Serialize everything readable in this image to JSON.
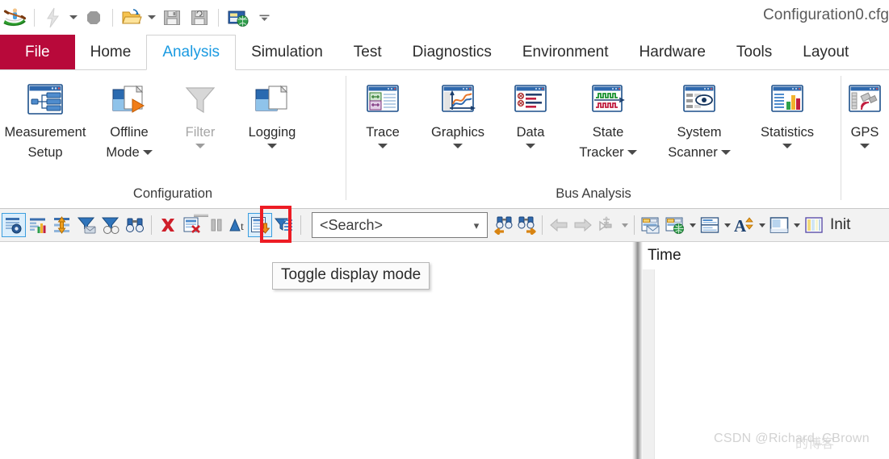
{
  "window": {
    "title": "Configuration0.cfg"
  },
  "quick_access": {
    "app_icon": "kayak-logo-icon",
    "items": [
      {
        "name": "lightning-icon",
        "label": ""
      },
      {
        "name": "stop-record-icon",
        "label": ""
      },
      {
        "name": "open-folder-icon",
        "label": ""
      },
      {
        "name": "save-icon",
        "label": ""
      },
      {
        "name": "save-as-icon",
        "label": ""
      },
      {
        "name": "network-config-icon",
        "label": ""
      }
    ],
    "overflow_label": "customize-quick-access"
  },
  "tabs": [
    {
      "label": "File",
      "active": false,
      "kind": "file"
    },
    {
      "label": "Home",
      "active": false,
      "kind": "normal"
    },
    {
      "label": "Analysis",
      "active": true,
      "kind": "normal"
    },
    {
      "label": "Simulation",
      "active": false,
      "kind": "normal"
    },
    {
      "label": "Test",
      "active": false,
      "kind": "normal"
    },
    {
      "label": "Diagnostics",
      "active": false,
      "kind": "normal"
    },
    {
      "label": "Environment",
      "active": false,
      "kind": "normal"
    },
    {
      "label": "Hardware",
      "active": false,
      "kind": "normal"
    },
    {
      "label": "Tools",
      "active": false,
      "kind": "normal"
    },
    {
      "label": "Layout",
      "active": false,
      "kind": "normal"
    }
  ],
  "ribbon": {
    "groups": [
      {
        "title": "Configuration",
        "buttons": [
          {
            "name": "measurement-setup",
            "line1": "Measurement",
            "line2": "Setup",
            "icon": "measurement-setup-icon",
            "dropdown": false,
            "disabled": false
          },
          {
            "name": "offline-mode",
            "line1": "Offline",
            "line2": "Mode",
            "icon": "offline-mode-icon",
            "dropdown": true,
            "inline_caret": true,
            "disabled": false
          },
          {
            "name": "filter",
            "line1": "Filter",
            "line2": "",
            "icon": "filter-icon",
            "dropdown": true,
            "inline_caret": false,
            "disabled": true
          },
          {
            "name": "logging",
            "line1": "Logging",
            "line2": "",
            "icon": "logging-icon",
            "dropdown": true,
            "inline_caret": false,
            "disabled": false
          }
        ]
      },
      {
        "title": "Bus Analysis",
        "buttons": [
          {
            "name": "trace",
            "line1": "Trace",
            "line2": "",
            "icon": "trace-icon",
            "dropdown": true,
            "inline_caret": false,
            "disabled": false
          },
          {
            "name": "graphics",
            "line1": "Graphics",
            "line2": "",
            "icon": "graphics-icon",
            "dropdown": true,
            "inline_caret": false,
            "disabled": false
          },
          {
            "name": "data",
            "line1": "Data",
            "line2": "",
            "icon": "data-icon",
            "dropdown": true,
            "inline_caret": false,
            "disabled": false
          },
          {
            "name": "state-tracker",
            "line1": "State",
            "line2": "Tracker",
            "icon": "state-tracker-icon",
            "dropdown": true,
            "inline_caret": true,
            "disabled": false
          },
          {
            "name": "system-scanner",
            "line1": "System",
            "line2": "Scanner",
            "icon": "system-scanner-icon",
            "dropdown": true,
            "inline_caret": true,
            "disabled": false
          },
          {
            "name": "statistics",
            "line1": "Statistics",
            "line2": "",
            "icon": "statistics-icon",
            "dropdown": true,
            "inline_caret": false,
            "disabled": false
          }
        ]
      },
      {
        "title": "",
        "buttons": [
          {
            "name": "gps",
            "line1": "GPS",
            "line2": "",
            "icon": "gps-icon",
            "dropdown": true,
            "inline_caret": false,
            "disabled": false
          }
        ]
      }
    ]
  },
  "toolbar": {
    "buttons": [
      {
        "name": "trace-settings-button",
        "icon": "trace-config-icon",
        "selected": true,
        "highlighted": false
      },
      {
        "name": "statistics-view-button",
        "icon": "bar-list-icon",
        "selected": false,
        "highlighted": false
      },
      {
        "name": "expand-rows-button",
        "icon": "expand-height-icon",
        "selected": false,
        "highlighted": false
      },
      {
        "name": "filter-messages-button",
        "icon": "funnel-card-icon",
        "selected": false,
        "highlighted": false
      },
      {
        "name": "analysis-filter-button",
        "icon": "funnel-glasses-icon",
        "selected": false,
        "highlighted": false
      },
      {
        "name": "find-button",
        "icon": "binoculars-icon",
        "selected": false,
        "highlighted": false
      },
      {
        "name": "clear-button",
        "icon": "red-x-icon",
        "selected": false,
        "highlighted": false
      },
      {
        "name": "clear-window-button",
        "icon": "clear-list-icon",
        "selected": false,
        "highlighted": false
      },
      {
        "name": "pause-button",
        "icon": "pause-icon",
        "selected": false,
        "highlighted": false,
        "disabled": true
      },
      {
        "name": "sort-by-time-button",
        "icon": "sort-at-icon",
        "selected": false,
        "highlighted": false,
        "disabled": true
      },
      {
        "name": "toggle-display-mode-button",
        "icon": "toggle-display-mode-icon",
        "selected": true,
        "highlighted": true
      },
      {
        "name": "column-filter-button",
        "icon": "funnel-lines-icon",
        "selected": false,
        "highlighted": false
      }
    ],
    "search": {
      "placeholder": "<Search>",
      "value": "<Search>"
    },
    "search_buttons": [
      {
        "name": "find-previous-button",
        "icon": "binoculars-back-icon"
      },
      {
        "name": "find-next-button",
        "icon": "binoculars-forward-icon"
      }
    ],
    "nav_buttons": [
      {
        "name": "navigate-back-button",
        "icon": "arrow-left-icon",
        "disabled": true
      },
      {
        "name": "navigate-forward-button",
        "icon": "arrow-right-icon",
        "disabled": true
      },
      {
        "name": "marker-button",
        "icon": "marker-icon",
        "disabled": true,
        "dropdown": true
      }
    ],
    "right_buttons": [
      {
        "name": "export-button",
        "icon": "export-mail-icon",
        "dropdown": false
      },
      {
        "name": "publish-web-button",
        "icon": "folder-globe-icon",
        "dropdown": true
      },
      {
        "name": "layout-button",
        "icon": "split-rows-icon",
        "dropdown": true
      },
      {
        "name": "font-size-button",
        "icon": "font-size-icon",
        "dropdown": true
      },
      {
        "name": "window-layout-button",
        "icon": "window-pane-icon",
        "dropdown": true
      },
      {
        "name": "color-columns-button",
        "icon": "color-bars-icon",
        "dropdown": false
      }
    ],
    "init_label": "Init"
  },
  "tooltip": {
    "text": "Toggle display mode"
  },
  "content": {
    "column_header": "Time"
  },
  "watermark": {
    "text": "CSDN @Richard_CBrown",
    "text_cn": "的博客"
  },
  "colors": {
    "file_tab": "#b8093a",
    "active_tab_text": "#1a9ae1",
    "highlight_box": "#ed1c24",
    "selection": "#dbeefc"
  }
}
